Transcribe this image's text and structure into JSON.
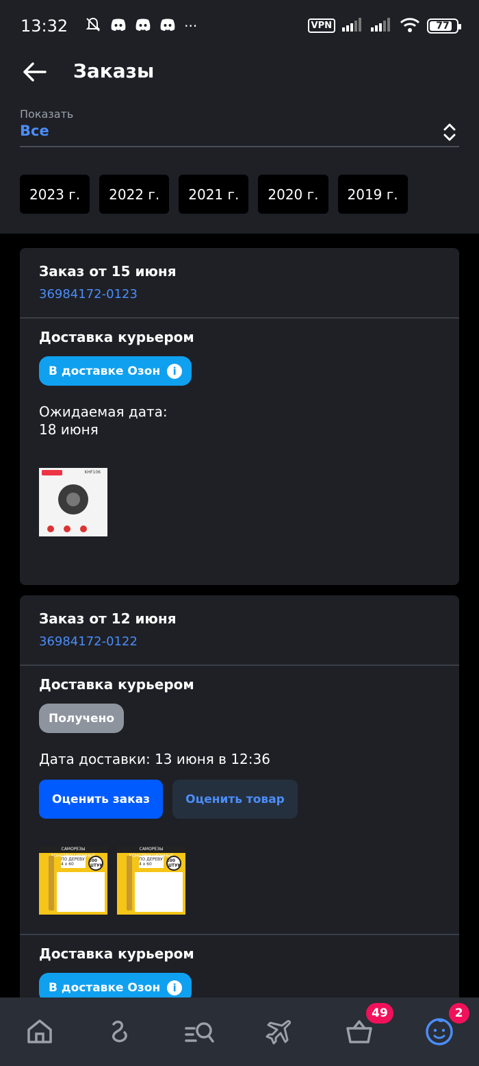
{
  "status_bar": {
    "time": "13:32",
    "vpn": "VPN",
    "battery": "77",
    "more": "···"
  },
  "header": {
    "title": "Заказы"
  },
  "filter": {
    "label": "Показать",
    "value": "Все"
  },
  "years": [
    "2023 г.",
    "2022 г.",
    "2021 г.",
    "2020 г.",
    "2019 г."
  ],
  "orders": [
    {
      "title": "Заказ от 15 июня",
      "number": "36984172-0123",
      "delivery_type": "Доставка курьером",
      "status": "В доставке Озон",
      "expected_label": "Ожидаемая дата:",
      "expected_date": "18 июня",
      "thumb": {
        "brand": "",
        "code": "KHF106"
      }
    },
    {
      "title": "Заказ от 12 июня",
      "number": "36984172-0122",
      "delivery_type": "Доставка курьером",
      "status": "Получено",
      "delivery_date": "Дата доставки: 13 июня в 12:36",
      "rate_order": "Оценить заказ",
      "rate_product": "Оценить товар",
      "thumb_text": {
        "top": "САМОРЕЗЫ КОНСТРУКЦИОННЫЕ",
        "size": "ПО ДЕРЕВУ 4 х 60",
        "badge": "200 ШТУК"
      },
      "second_delivery_type": "Доставка курьером",
      "second_status": "В доставке Озон"
    }
  ],
  "bottom_nav": {
    "cart_count": "49",
    "profile_count": "2"
  },
  "colors": {
    "background": "#000000",
    "surface": "#1e2026",
    "accent": "#4b8df8",
    "primary_button": "#005bff",
    "status_blue": "#10a0f0",
    "badge": "#f1115a"
  }
}
